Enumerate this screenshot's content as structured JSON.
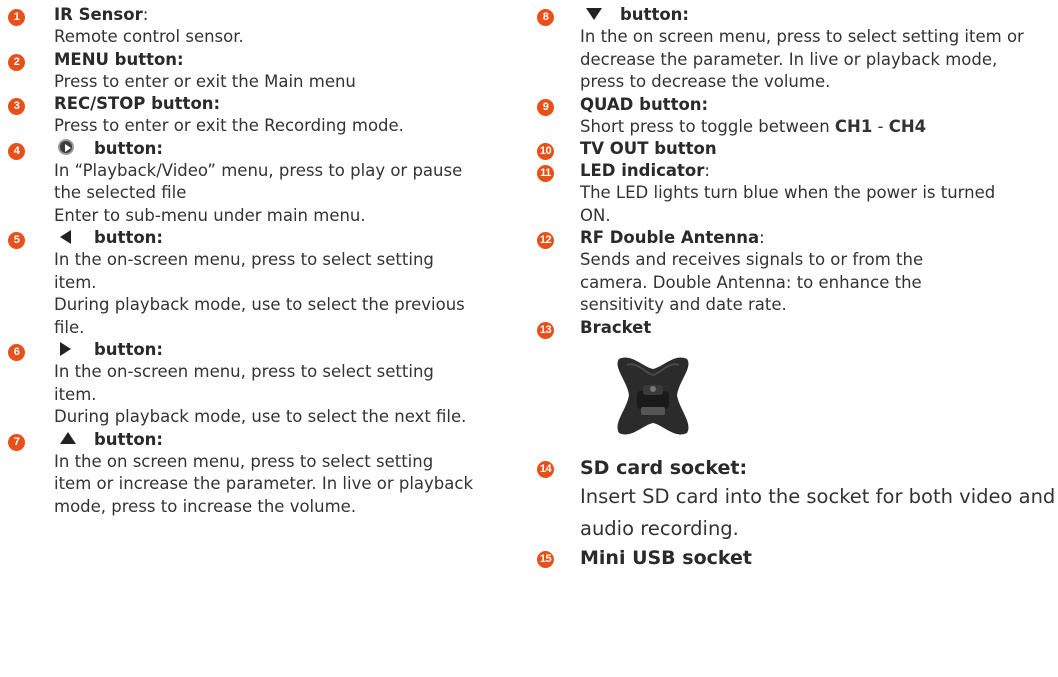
{
  "left": [
    {
      "num": "1",
      "title": "IR Sensor",
      "title_suffix": ":",
      "lines": [
        "Remote control sensor."
      ]
    },
    {
      "num": "2",
      "title": "MENU button:",
      "lines": [
        "Press to enter or exit the Main menu"
      ]
    },
    {
      "num": "3",
      "title": "REC/STOP button:",
      "lines": [
        "Press to enter or exit the Recording mode."
      ]
    },
    {
      "num": "4",
      "title": "button:",
      "icon": "play-circle-icon",
      "lines": [
        "In “Playback/Video” menu, press to play or pause the selected file",
        "Enter to sub-menu under main menu."
      ]
    },
    {
      "num": "5",
      "title": "button:",
      "icon": "left-triangle-icon",
      "lines": [
        "In the on-screen menu, press to select setting item.",
        "During playback mode, use to select the previous file."
      ]
    },
    {
      "num": "6",
      "title": "button:",
      "icon": "right-triangle-icon",
      "lines": [
        "In the on-screen menu, press to select setting item.",
        "During playback mode, use to select the next file."
      ]
    },
    {
      "num": "7",
      "title": "button:",
      "icon": "up-triangle-icon",
      "lines": [
        "In the on screen menu, press to select setting item or increase the parameter. In live or playback mode, press to increase the volume."
      ]
    }
  ],
  "right": [
    {
      "num": "8",
      "title": "button:",
      "icon": "down-triangle-icon",
      "lines": [
        "In the on screen menu, press to select setting item or decrease the parameter. In live or playback mode, press to decrease the volume."
      ]
    },
    {
      "num": "9",
      "title": "QUAD button:",
      "lines_rich": [
        {
          "pre": "Short press to toggle between ",
          "b1": "CH1",
          "mid": " - ",
          "b2": "CH4"
        }
      ]
    },
    {
      "num": "10",
      "title": "TV OUT button"
    },
    {
      "num": "11",
      "title": "LED indicator",
      "title_suffix": ":",
      "lines": [
        "The LED lights turn blue when the power is turned ON."
      ]
    },
    {
      "num": "12",
      "title": "RF Double Antenna",
      "title_suffix": ":",
      "lines": [
        "Sends and receives signals to or from the camera. Double Antenna: to enhance the sensitivity and date rate."
      ]
    },
    {
      "num": "13",
      "title": "Bracket"
    },
    {
      "num": "14",
      "title": "SD card socket:",
      "lines": [
        "Insert SD card into the socket for both video and audio recording."
      ]
    },
    {
      "num": "15",
      "title": "Mini USB socket"
    }
  ],
  "colors": {
    "badge": "#e8501a",
    "text": "#2a2a2a"
  }
}
